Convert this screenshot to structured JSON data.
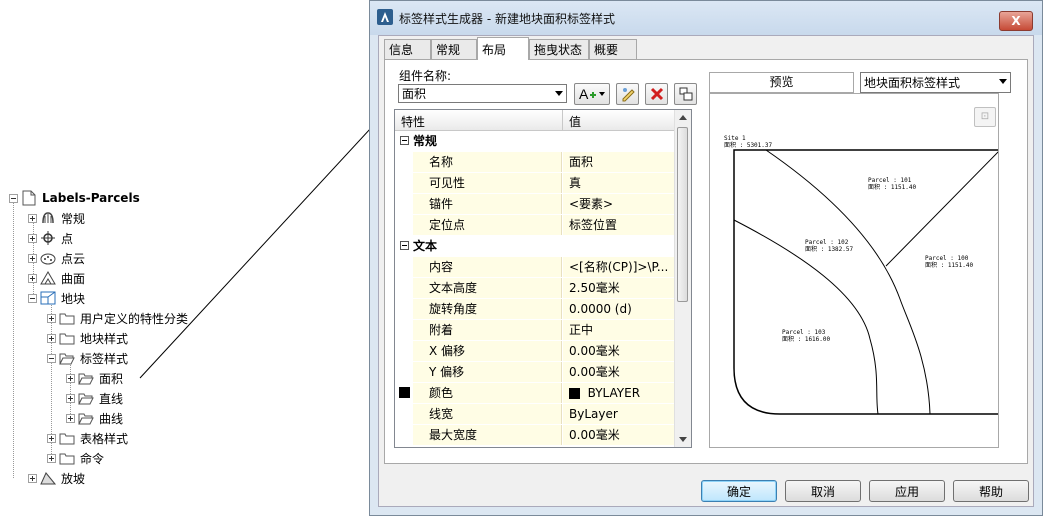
{
  "tree": {
    "root": "Labels-Parcels",
    "items": [
      {
        "label": "常规",
        "icon": "settings-icon"
      },
      {
        "label": "点",
        "icon": "point-icon"
      },
      {
        "label": "点云",
        "icon": "point-cloud-icon"
      },
      {
        "label": "曲面",
        "icon": "surface-icon"
      },
      {
        "label": "地块",
        "icon": "parcel-icon"
      },
      {
        "label": "用户定义的特性分类",
        "icon": "folder-icon"
      },
      {
        "label": "地块样式",
        "icon": "folder-icon"
      },
      {
        "label": "标签样式",
        "icon": "folder-icon"
      },
      {
        "label": "面积",
        "icon": "folder-icon"
      },
      {
        "label": "直线",
        "icon": "folder-icon"
      },
      {
        "label": "曲线",
        "icon": "folder-icon"
      },
      {
        "label": "表格样式",
        "icon": "folder-icon"
      },
      {
        "label": "命令",
        "icon": "folder-icon"
      },
      {
        "label": "放坡",
        "icon": "grading-icon"
      }
    ]
  },
  "dialog": {
    "title": "标签样式生成器 - 新建地块面积标签样式",
    "close_label": "X",
    "tabs": [
      "信息",
      "常规",
      "布局",
      "拖曳状态",
      "概要"
    ],
    "active_tab": "布局",
    "component_name_label": "组件名称:",
    "component_name_value": "面积",
    "grid": {
      "col_property": "特性",
      "col_value": "值",
      "rows": [
        {
          "type": "category",
          "name": "常规"
        },
        {
          "type": "prop",
          "name": "名称",
          "value": "面积"
        },
        {
          "type": "prop",
          "name": "可见性",
          "value": "真"
        },
        {
          "type": "prop",
          "name": "锚件",
          "value": "<要素>"
        },
        {
          "type": "prop",
          "name": "定位点",
          "value": "标签位置"
        },
        {
          "type": "category",
          "name": "文本"
        },
        {
          "type": "prop",
          "name": "内容",
          "value": "<[名称(CP)]>\\P..."
        },
        {
          "type": "prop",
          "name": "文本高度",
          "value": "2.50毫米"
        },
        {
          "type": "prop",
          "name": "旋转角度",
          "value": "0.0000 (d)"
        },
        {
          "type": "prop",
          "name": "附着",
          "value": "正中"
        },
        {
          "type": "prop",
          "name": "X 偏移",
          "value": "0.00毫米"
        },
        {
          "type": "prop",
          "name": "Y 偏移",
          "value": "0.00毫米"
        },
        {
          "type": "prop",
          "name": "颜色",
          "value": "BYLAYER",
          "swatch": "#000000"
        },
        {
          "type": "prop",
          "name": "线宽",
          "value": "ByLayer"
        },
        {
          "type": "prop",
          "name": "最大宽度",
          "value": "0.00毫米"
        }
      ]
    },
    "preview": {
      "label": "预览",
      "style_select": "地块面积标签样式",
      "labels": [
        {
          "title": "Site 1",
          "area": "面积 : 5301.37"
        },
        {
          "title": "Parcel : 101",
          "area": "面积 : 1151.40"
        },
        {
          "title": "Parcel : 102",
          "area": "面积 : 1382.57"
        },
        {
          "title": "Parcel : 100",
          "area": "面积 : 1151.40"
        },
        {
          "title": "Parcel : 103",
          "area": "面积 : 1616.00"
        }
      ]
    },
    "buttons": {
      "ok": "确定",
      "cancel": "取消",
      "apply": "应用",
      "help": "帮助"
    }
  },
  "colors": {
    "grid_value_bg": "#fffde5",
    "dialog_frame": "#dce7f2",
    "close_red": "#c64a36",
    "default_btn": "#3c7fb1"
  }
}
